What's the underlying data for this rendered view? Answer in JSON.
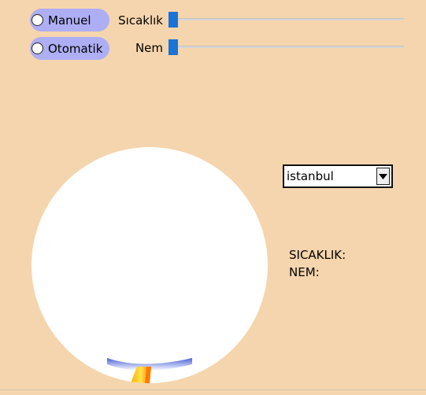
{
  "mode": {
    "options": [
      {
        "label": "Manuel",
        "checked": false
      },
      {
        "label": "Otomatik",
        "checked": false
      }
    ]
  },
  "sliders": {
    "temperature": {
      "label": "Sıcaklık",
      "level": 0
    },
    "humidity": {
      "label": "Nem",
      "level": 0
    }
  },
  "city_select": {
    "selected": "istanbul"
  },
  "readout": {
    "temperature_label": "SICAKLIK:",
    "humidity_label": "NEM:"
  },
  "colors": {
    "background": "#f5d5ad",
    "radio_pill": "#aeaef5",
    "slider_thumb": "#1a73d6",
    "gauge_face": "#ffffff",
    "liquid_blue": "#5a72e0",
    "tube_orange": "#ff8a00",
    "tube_yellow": "#ffd21a"
  },
  "icons": {
    "dropdown": "triangle-down-icon"
  }
}
